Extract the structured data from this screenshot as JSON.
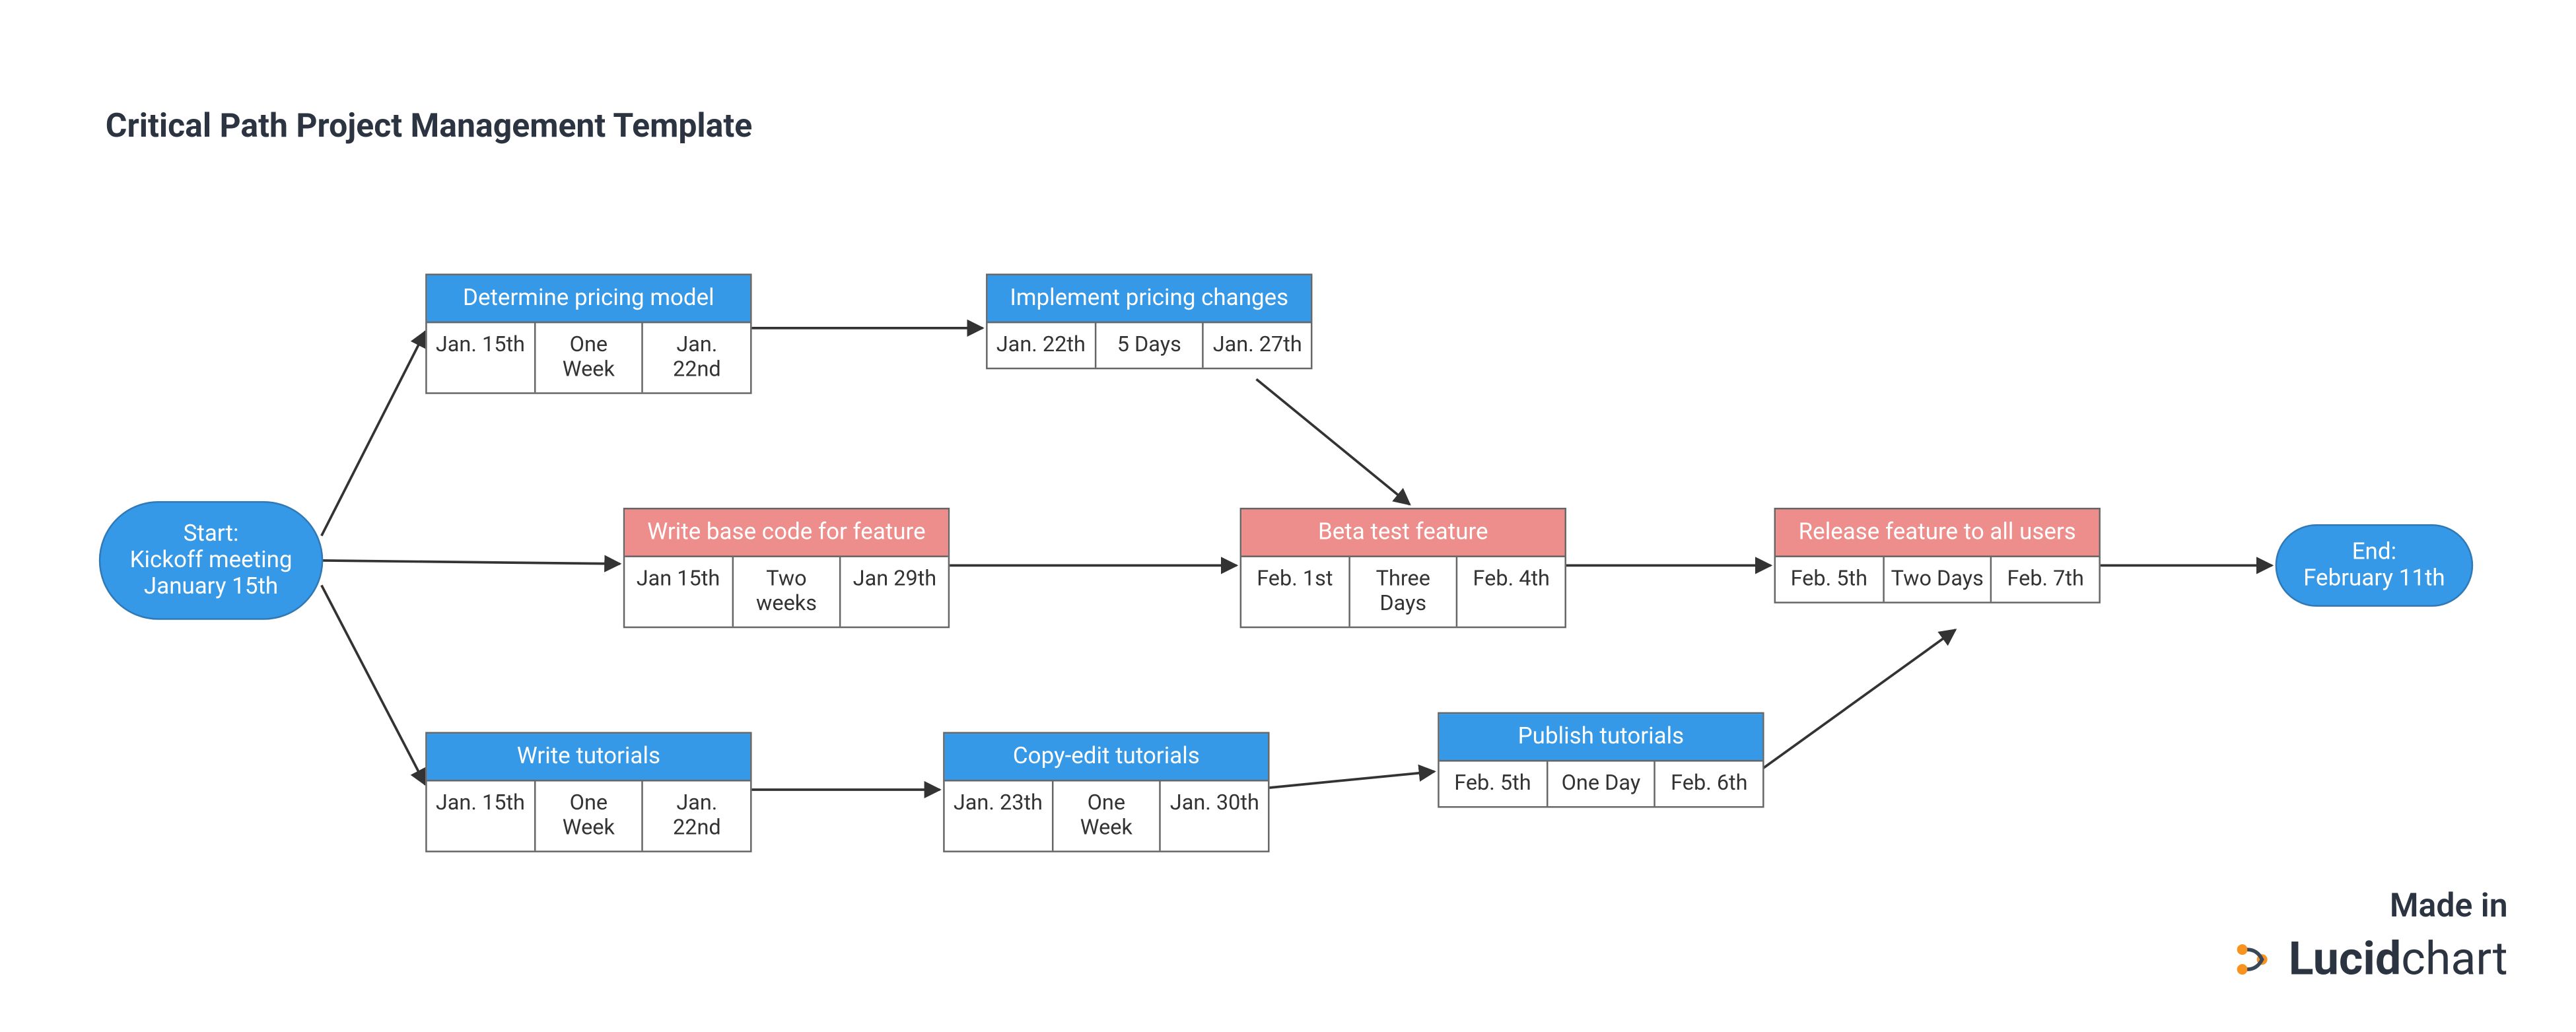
{
  "title": "Critical Path Project Management Template",
  "start": {
    "line1": "Start:",
    "line2": "Kickoff meeting",
    "line3": "January 15th"
  },
  "end": {
    "line1": "End:",
    "line2": "February 11th"
  },
  "nodes": {
    "pricing_model": {
      "label": "Determine pricing model",
      "start": "Jan. 15th",
      "dur": "One Week",
      "end": "Jan. 22nd"
    },
    "pricing_impl": {
      "label": "Implement pricing changes",
      "start": "Jan. 22th",
      "dur": "5 Days",
      "end": "Jan. 27th"
    },
    "base_code": {
      "label": "Write base code for feature",
      "start": "Jan 15th",
      "dur": "Two weeks",
      "end": "Jan 29th"
    },
    "beta_test": {
      "label": "Beta test feature",
      "start": "Feb. 1st",
      "dur": "Three Days",
      "end": "Feb. 4th"
    },
    "release": {
      "label": "Release feature to all users",
      "start": "Feb. 5th",
      "dur": "Two Days",
      "end": "Feb. 7th"
    },
    "write_tut": {
      "label": "Write tutorials",
      "start": "Jan. 15th",
      "dur": "One Week",
      "end": "Jan. 22nd"
    },
    "copy_tut": {
      "label": "Copy-edit tutorials",
      "start": "Jan. 23th",
      "dur": "One Week",
      "end": "Jan. 30th"
    },
    "publish_tut": {
      "label": "Publish tutorials",
      "start": "Feb. 5th",
      "dur": "One Day",
      "end": "Feb. 6th"
    }
  },
  "footer": {
    "made_in": "Made in",
    "brand_lucid": "Lucid",
    "brand_chart": "chart"
  },
  "colors": {
    "blue": "#3699e8",
    "red": "#ee8e8c"
  }
}
